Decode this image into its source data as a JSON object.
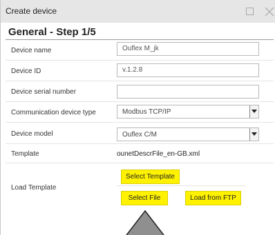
{
  "window": {
    "title": "Create device"
  },
  "step": {
    "title": "General - Step 1/5"
  },
  "fields": {
    "device_name": {
      "label": "Device name",
      "value": "Ouflex M_jk"
    },
    "device_id": {
      "label": "Device ID",
      "value": "v.1.2.8"
    },
    "serial_number": {
      "label": "Device serial number",
      "value": ""
    },
    "comm_type": {
      "label": "Communication device type",
      "value": "Modbus TCP/IP"
    },
    "device_model": {
      "label": "Device model",
      "value": "Ouflex C/M"
    },
    "template": {
      "label": "Template",
      "value": "ounetDescrFile_en-GB.xml"
    },
    "load_template": {
      "label": "Load Template"
    }
  },
  "buttons": {
    "select_template": "Select Template",
    "select_file": "Select File",
    "load_from_ftp": "Load from FTP"
  },
  "colors": {
    "button_yellow": "#fff200",
    "titlebar_bg": "#e6e6e6"
  },
  "icons": {
    "maximize": "maximize-icon",
    "close": "close-icon",
    "dropdown": "triangle-down-icon"
  }
}
